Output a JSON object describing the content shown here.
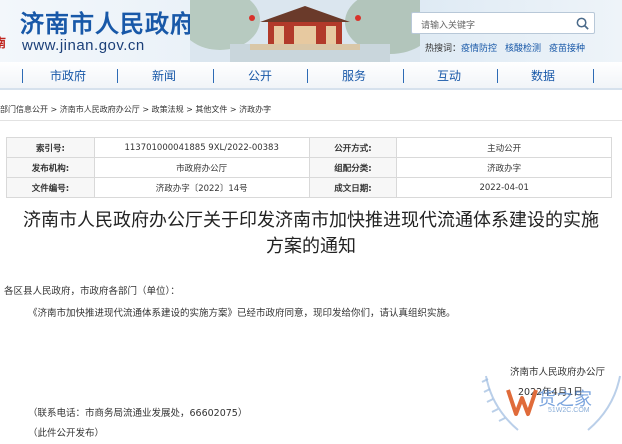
{
  "header": {
    "site_title": "济南市人民政府",
    "site_url": "www.jinan.gov.cn",
    "search": {
      "placeholder": "请输入关键字"
    },
    "hot": {
      "label": "热搜词：",
      "links": [
        "疫情防控",
        "核酸检测",
        "疫苗接种"
      ]
    }
  },
  "nav": {
    "items": [
      "市政府",
      "新闻",
      "公开",
      "服务",
      "互动",
      "数据"
    ]
  },
  "breadcrumb": "部门信息公开 > 济南市人民政府办公厅 > 政策法规 > 其他文件 > 济政办字",
  "info": {
    "rows": [
      {
        "k1": "索引号:",
        "v1": "113701000041885 9XL/2022-00383",
        "k2": "公开方式:",
        "v2": "主动公开"
      },
      {
        "k1": "发布机构:",
        "v1": "市政府办公厅",
        "k2": "组配分类:",
        "v2": "济政办字"
      },
      {
        "k1": "文件编号:",
        "v1": "济政办字〔2022〕14号",
        "k2": "成文日期:",
        "v2": "2022-04-01"
      }
    ]
  },
  "doc": {
    "title_line1": "济南市人民政府办公厅关于印发济南市加快推进现代流通体系建设的实施",
    "title_line2": "方案的通知",
    "salutation": "各区县人民政府，市政府各部门（单位）：",
    "body": "《济南市加快推进现代流通体系建设的实施方案》已经市政府同意，现印发给你们，请认真组织实施。",
    "signer": "济南市人民政府办公厅",
    "date": "2022年4月1日",
    "contact": "（联系电话：市商务局流通业发展处，66602075）",
    "publish_note": "（此件公开发布）"
  },
  "watermark": {
    "name": "货之家",
    "url": "51W2C.COM"
  },
  "colors": {
    "brand_blue": "#1858a8",
    "seal_red": "#c0241d"
  }
}
